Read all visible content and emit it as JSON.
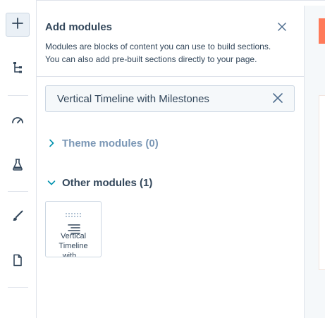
{
  "rail": {
    "items": [
      {
        "name": "add",
        "icon": "plus-icon"
      },
      {
        "name": "tree",
        "icon": "tree-structure-icon"
      },
      {
        "name": "optimize",
        "icon": "speedometer-icon"
      },
      {
        "name": "test",
        "icon": "flask-icon"
      },
      {
        "name": "design",
        "icon": "brush-icon"
      },
      {
        "name": "page",
        "icon": "document-icon"
      }
    ]
  },
  "panel": {
    "title": "Add modules",
    "description": "Modules are blocks of content you can use to build sections. You can also add pre-built sections directly to your page."
  },
  "search": {
    "value": "Vertical Timeline with Milestones"
  },
  "sections": {
    "theme_label": "Theme modules (0)",
    "other_label": "Other modules (1)"
  },
  "module": {
    "name": "Vertical Timeline with…",
    "icon": "list-layout-icon"
  },
  "colors": {
    "text": "#33475b",
    "muted": "#7c98b6",
    "accent": "#ff7a59",
    "border": "#cbd6e2"
  }
}
